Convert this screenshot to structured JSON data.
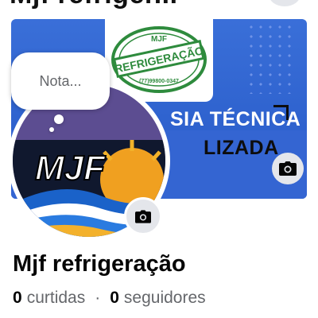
{
  "top": {
    "title_partial": "Mjf refriger..."
  },
  "cover": {
    "stamp": {
      "top_text": "MJF",
      "main_text": "REFRIGERAÇÃO",
      "phone": "(77)99800-0347"
    },
    "text_line_1": "SIA TÉCNICA",
    "text_line_2": "LIZADA",
    "camera_icon": "camera-icon"
  },
  "avatar": {
    "logo_text": "MJF",
    "camera_icon": "camera-icon"
  },
  "note": {
    "placeholder": "Nota..."
  },
  "profile": {
    "name": "Mjf refrigeração",
    "likes_count": "0",
    "likes_label": "curtidas",
    "separator": "·",
    "followers_count": "0",
    "followers_label": "seguidores"
  },
  "colors": {
    "cover_blue": "#3a6fd8",
    "stamp_green": "#2e8b3d",
    "secondary_text": "#65676b",
    "button_gray": "#e4e6eb"
  }
}
